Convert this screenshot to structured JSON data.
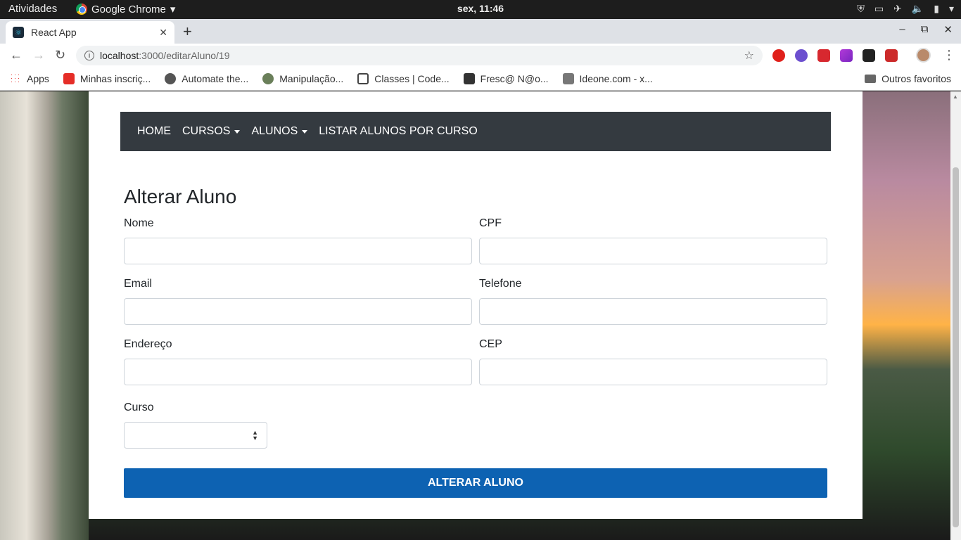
{
  "topbar": {
    "activities": "Atividades",
    "app_name": "Google Chrome",
    "clock": "sex, 11:46"
  },
  "browser": {
    "tab_title": "React App",
    "url_host": "localhost",
    "url_path": ":3000/editarAluno/19",
    "bookmarks": [
      {
        "label": "Apps",
        "icon": "apps-grid-icon"
      },
      {
        "label": "Minhas inscriç...",
        "icon": "youtube-icon"
      },
      {
        "label": "Automate the...",
        "icon": "globe-icon"
      },
      {
        "label": "Manipulação...",
        "icon": "site-icon"
      },
      {
        "label": "Classes | Code...",
        "icon": "doc-icon"
      },
      {
        "label": "Fresc@ N@o...",
        "icon": "site-icon"
      },
      {
        "label": "Ideone.com - x...",
        "icon": "ideone-icon"
      }
    ],
    "other_bookmarks": "Outros favoritos"
  },
  "navbar": {
    "home": "HOME",
    "cursos": "CURSOS",
    "alunos": "ALUNOS",
    "listar": "LISTAR ALUNOS POR CURSO"
  },
  "form": {
    "title": "Alterar Aluno",
    "nome_label": "Nome",
    "cpf_label": "CPF",
    "email_label": "Email",
    "telefone_label": "Telefone",
    "endereco_label": "Endereço",
    "cep_label": "CEP",
    "curso_label": "Curso",
    "nome_value": "",
    "cpf_value": "",
    "email_value": "",
    "telefone_value": "",
    "endereco_value": "",
    "cep_value": "",
    "curso_value": "",
    "submit_label": "ALTERAR ALUNO"
  },
  "colors": {
    "navbar_bg": "#343a40",
    "submit_bg": "#0d62b2"
  }
}
